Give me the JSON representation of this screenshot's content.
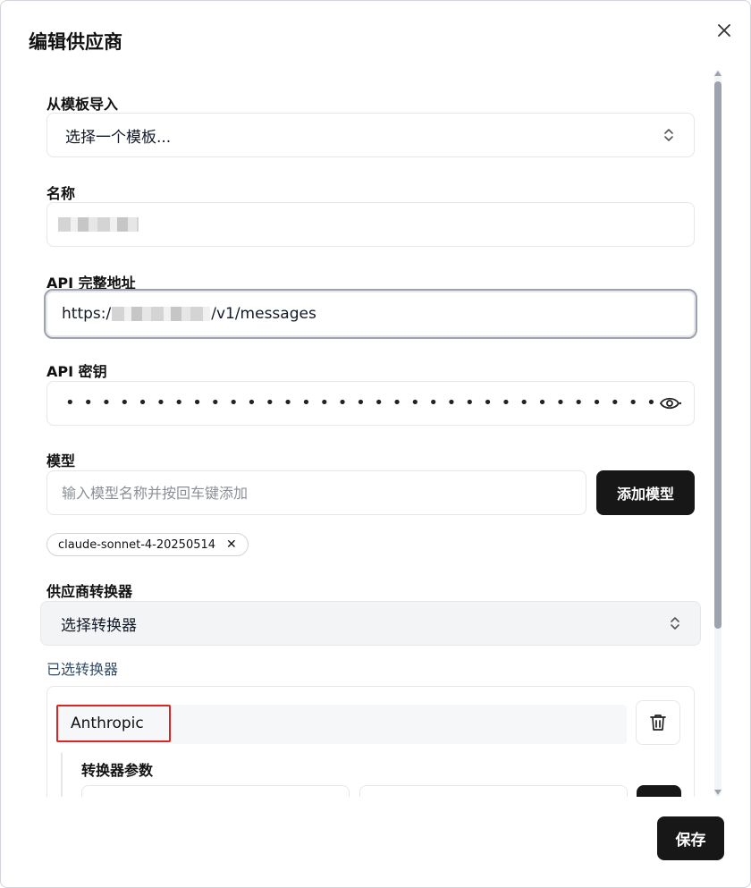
{
  "dialog": {
    "title": "编辑供应商",
    "close_icon": "close-icon"
  },
  "template": {
    "label": "从模板导入",
    "value": "选择一个模板..."
  },
  "name": {
    "label": "名称",
    "value": ""
  },
  "api_url": {
    "label": "API 完整地址",
    "prefix": "https:/",
    "suffix": "/v1/messages"
  },
  "api_key": {
    "label": "API 密钥",
    "masked_value": "••••••••••••••••••••••••••••••••••••••••••••••••••••••••••••",
    "toggle_icon": "eye-icon"
  },
  "models": {
    "label": "模型",
    "placeholder": "输入模型名称并按回车键添加",
    "add_button": "添加模型",
    "chips": [
      "claude-sonnet-4-20250514"
    ]
  },
  "transformer": {
    "label": "供应商转换器",
    "select_value": "选择转换器",
    "selected_label": "已选转换器",
    "selected": [
      {
        "name": "Anthropic",
        "params_label": "转换器参数"
      }
    ]
  },
  "footer": {
    "save_label": "保存"
  }
}
